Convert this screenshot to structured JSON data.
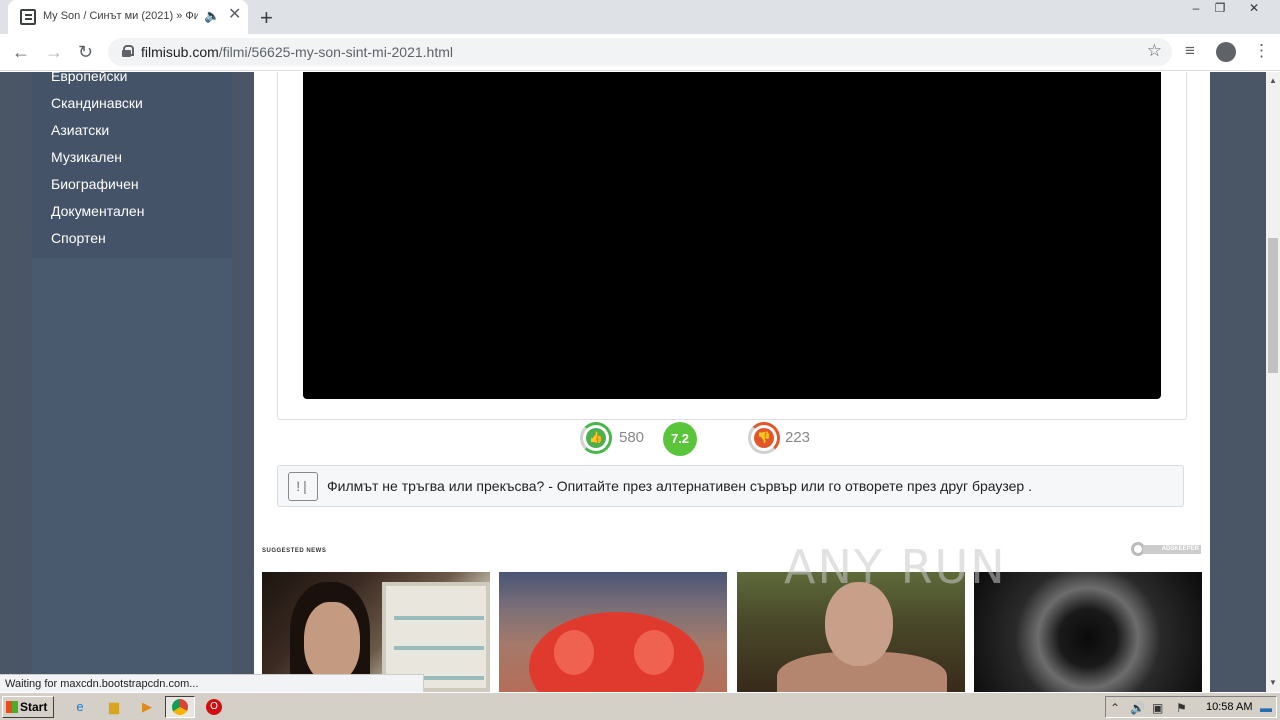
{
  "browser": {
    "tab_title": "My Son / Синът ми (2021) » Фи",
    "tab_close": "✕",
    "tab_audio_icon": "🔈",
    "new_tab": "+",
    "window_controls": {
      "minimize": "‒",
      "restore": "❐",
      "close": "✕"
    },
    "url_domain": "filmisub.com",
    "url_path": "/filmi/56625-my-son-sint-mi-2021.html",
    "back": "←",
    "forward": "→",
    "reload": "↻",
    "star": "☆",
    "media_icon": "≡",
    "menu_icon": "⋮"
  },
  "sidebar": {
    "items": [
      "Европейски",
      "Скандинавски",
      "Азиатски",
      "Музикален",
      "Биографичен",
      "Документален",
      "Спортен"
    ]
  },
  "rating": {
    "likes": "580",
    "score": "7.2",
    "dislikes": "223"
  },
  "notice": {
    "icon": "!|",
    "text": "Филмът не тръгва или прекъсва? - Опитайте през алтернативен сървър или го отворете през друг браузер ."
  },
  "suggested": {
    "label": "SUGGESTED NEWS",
    "ad_brand": "ADSKEEPER"
  },
  "watermark": "ANY RUN",
  "status_text": "Waiting for maxcdn.bootstrapcdn.com...",
  "taskbar": {
    "start": "Start",
    "clock": "10:58 AM"
  },
  "colors": {
    "page_bg": "#4a5566",
    "sidebar_bg": "#495a6e",
    "like_green": "#4caf50",
    "score_green": "#5ac53b",
    "dislike_red": "#e2572a"
  }
}
